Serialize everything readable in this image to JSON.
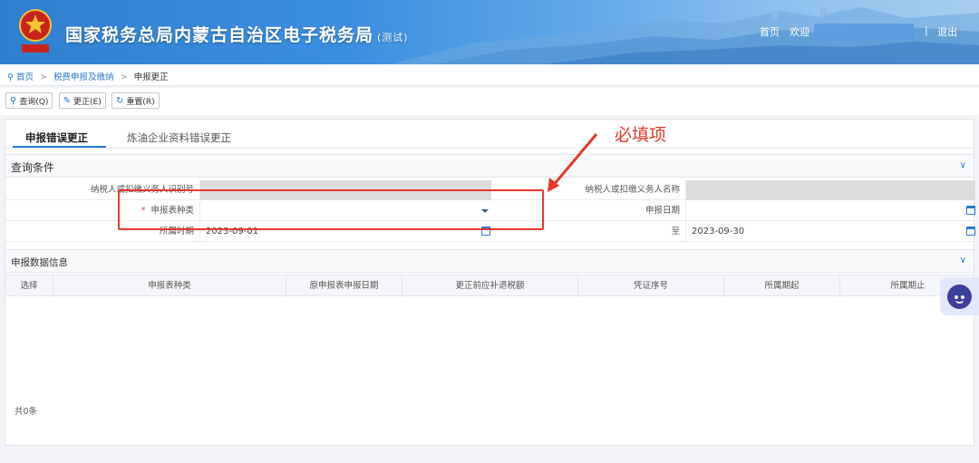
{
  "header": {
    "site_title": "国家税务总局内蒙古自治区电子税务局",
    "test_tag": "(测试)",
    "home_link": "首页",
    "welcome": "欢迎",
    "logout": "退出",
    "separator": "|"
  },
  "breadcrumb": {
    "home": "首页",
    "sep1": ">",
    "level2": "税费申报及缴纳",
    "sep2": ">",
    "current": "申报更正"
  },
  "toolbar": {
    "query_label": "查询(Q)",
    "correct_label": "更正(E)",
    "reset_label": "重置(R)"
  },
  "tabs": [
    {
      "label": "申报错误更正",
      "active": true
    },
    {
      "label": "炼油企业资料错误更正",
      "active": false
    }
  ],
  "query_section": {
    "title": "查询条件",
    "taxpayer_id_label": "纳税人或扣缴义务人识别号",
    "taxpayer_id_value": "",
    "taxpayer_name_label": "纳税人或扣缴义务人名称",
    "taxpayer_name_value": "",
    "required_mark": "*",
    "form_type_label": "申报表种类",
    "form_type_value": "",
    "declare_date_label": "申报日期",
    "declare_date_value": "",
    "period_label": "所属时期",
    "period_start": "2023-09-01",
    "period_to_label": "至",
    "period_end": "2023-09-30"
  },
  "data_section": {
    "title": "申报数据信息",
    "columns": [
      "选择",
      "申报表种类",
      "原申报表申报日期",
      "更正前应补退税额",
      "凭证序号",
      "所属期起",
      "所属期止"
    ],
    "rows": [],
    "total_text": "共0条"
  },
  "annotation": {
    "text": "必填项"
  },
  "colors": {
    "accent": "#2a7ad2",
    "annotation_red": "#e8372a",
    "header_blue": "#3a8ee0"
  }
}
